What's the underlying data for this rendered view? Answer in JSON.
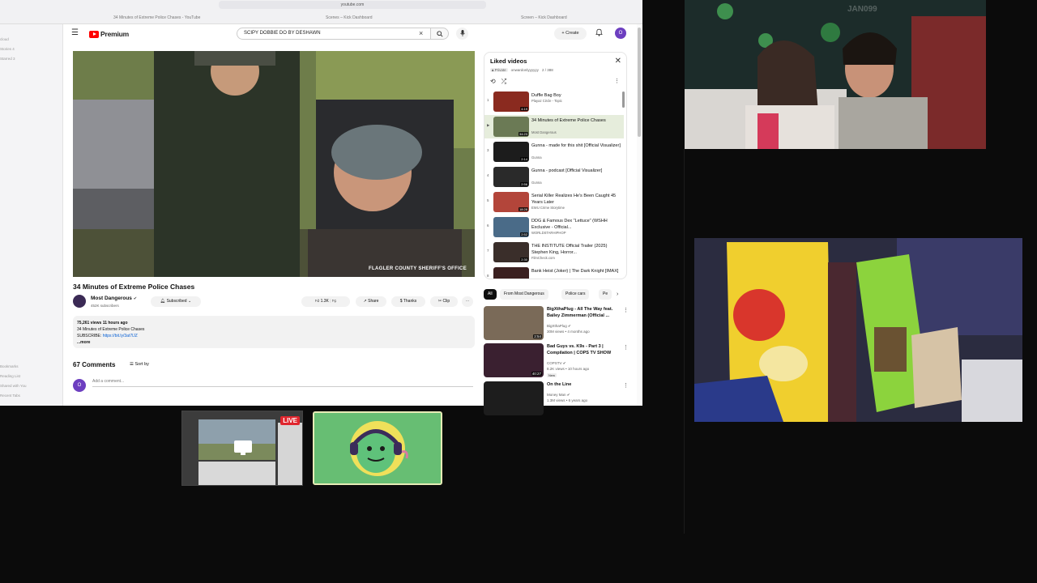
{
  "browser": {
    "url": "youtube.com",
    "tabs": [
      "34 Minutes of Extreme Police Chases - YouTube",
      "Scenes – Kick Dashboard",
      "Screen – Kick Dashboard"
    ],
    "sidebar_items": [
      "Tabs",
      "cloud",
      "Stories 4",
      "Starred 3",
      "Bookmarks",
      "Reading List",
      "Shared with You",
      "Recent Tabs"
    ]
  },
  "header": {
    "logo_text": "Premium",
    "search_value": "SCIPY DOBBIE DO BY DESHAWN",
    "create_label": "Create",
    "avatar_letter": "O"
  },
  "player": {
    "watermark": "FLAGLER COUNTY SHERIFF'S OFFICE"
  },
  "video": {
    "title": "34 Minutes of Extreme Police Chases",
    "channel": "Most Dangerous",
    "subscribers": "452K subscribers",
    "subscribed_label": "Subscribed",
    "likes": "1.3K",
    "share_label": "Share",
    "thanks_label": "Thanks",
    "clip_label": "Clip",
    "description": {
      "stats": "75,261 views  11 hours ago",
      "line1": "34 Minutes of Extreme Police Chases",
      "subscribe_prefix": "SUBSCRIBE: ",
      "subscribe_link": "https://bit.ly/3at7lJZ",
      "more": "...more"
    }
  },
  "comments": {
    "count": "67 Comments",
    "sort_label": "Sort by",
    "avatar_letter": "O",
    "placeholder": "Add a comment..."
  },
  "playlist": {
    "title": "Liked videos",
    "privacy": "Private",
    "owner": "onwardonlyyyyyy",
    "position": "2 / 388",
    "items": [
      {
        "index": "1",
        "title": "Duffle Bag Boy",
        "channel": "Playaz Circle - Topic",
        "duration": "4:19",
        "color": "#8a2a1f"
      },
      {
        "index": "▶",
        "title": "34 Minutes of Extreme Police Chases",
        "channel": "Most Dangerous",
        "duration": "34:23",
        "color": "#6b7a55"
      },
      {
        "index": "3",
        "title": "Gunna - made for this shit [Official Visualizer]",
        "channel": "Gunna",
        "duration": "2:14",
        "color": "#1c1c1c"
      },
      {
        "index": "4",
        "title": "Gunna - podcast [Official Visualizer]",
        "channel": "Gunna",
        "duration": "2:56",
        "color": "#2a2a2a"
      },
      {
        "index": "5",
        "title": "Serial Killer Realizes He's Been Caught 45 Years Later",
        "channel": "EWU Crime Storytime",
        "duration": "18:28",
        "color": "#b3453a"
      },
      {
        "index": "6",
        "title": "DDG & Famous Dex \"Lettuce\" (WSHH Exclusive - Official...",
        "channel": "WORLDSTARHIPHOP",
        "duration": "2:52",
        "color": "#4a6b88"
      },
      {
        "index": "7",
        "title": "THE INSTITUTE Official Trailer (2025) Stephen King, Horror...",
        "channel": "FilmCheck.com",
        "duration": "2:30",
        "color": "#3a2e2a"
      },
      {
        "index": "8",
        "title": "Bank Heist (Joker) | The Dark Knight [IMAX]",
        "channel": "",
        "duration": "",
        "color": "#3b2020"
      }
    ]
  },
  "chips": [
    "All",
    "From Most Dangerous",
    "Police cars",
    "Pe"
  ],
  "recommended": [
    {
      "title": "BigXthaPlug - All The Way feat. Bailey Zimmerman (Official ...",
      "channel": "BigXthaPlug",
      "stats": "30M views • 4 months ago",
      "duration": "2:54",
      "badge": "",
      "color": "#7a6a58"
    },
    {
      "title": "Bad Guys vs. K9s - Part 3 | Compilation | COPS TV SHOW",
      "channel": "COPSTV",
      "stats": "8.2K views • 10 hours ago",
      "duration": "40:27",
      "badge": "New",
      "color": "#3a2030"
    },
    {
      "title": "On the Line",
      "channel": "Money Man",
      "stats": "1.3M views • 6 years ago",
      "duration": "",
      "badge": "",
      "color": "#1d1d1d"
    }
  ],
  "cam1": {
    "watermark": "JAN099"
  },
  "bottom": {
    "live_label": "LIVE"
  }
}
